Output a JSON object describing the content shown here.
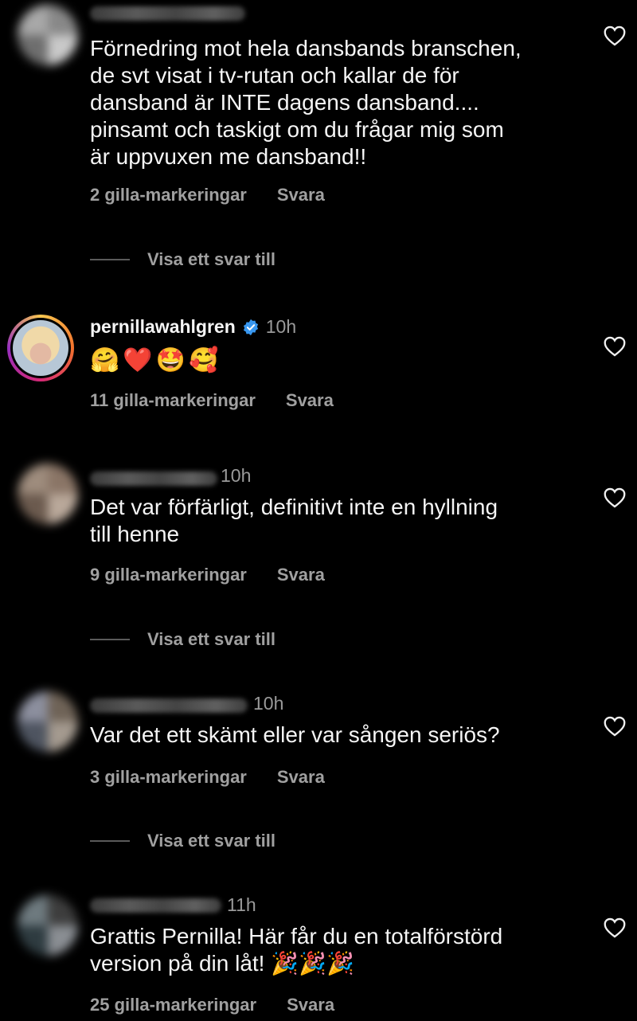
{
  "comments": [
    {
      "time": "",
      "text": [
        "Förnedring mot hela dansbands branschen,",
        "de svt visat i tv-rutan och kallar de för",
        "dansband är INTE dagens dansband....",
        "pinsamt och taskigt om du frågar mig som",
        "är uppvuxen me dansband!!"
      ],
      "likes": "2 gilla-markeringar",
      "reply": "Svara",
      "show_replies": "Visa ett svar till"
    },
    {
      "username": "pernillawahlgren",
      "time": "10h",
      "emojis": "🤗❤️🤩🥰",
      "likes": "11 gilla-markeringar",
      "reply": "Svara"
    },
    {
      "time": "10h",
      "text": [
        "Det var förfärligt, definitivt inte en hyllning",
        "till henne"
      ],
      "likes": "9 gilla-markeringar",
      "reply": "Svara",
      "show_replies": "Visa ett svar till"
    },
    {
      "time": "10h",
      "text": [
        "Var det ett skämt eller var sången seriös?"
      ],
      "likes": "3 gilla-markeringar",
      "reply": "Svara",
      "show_replies": "Visa ett svar till"
    },
    {
      "time": "11h",
      "text": [
        "Grattis Pernilla! Här får du en totalförstörd",
        "version på din låt! 🎉🎉🎉"
      ],
      "likes": "25 gilla-markeringar",
      "reply": "Svara"
    }
  ],
  "colors": {
    "background": "#000000",
    "text": "#f5f5f5",
    "muted": "#a0a0a0",
    "verified": "#3897f0"
  }
}
